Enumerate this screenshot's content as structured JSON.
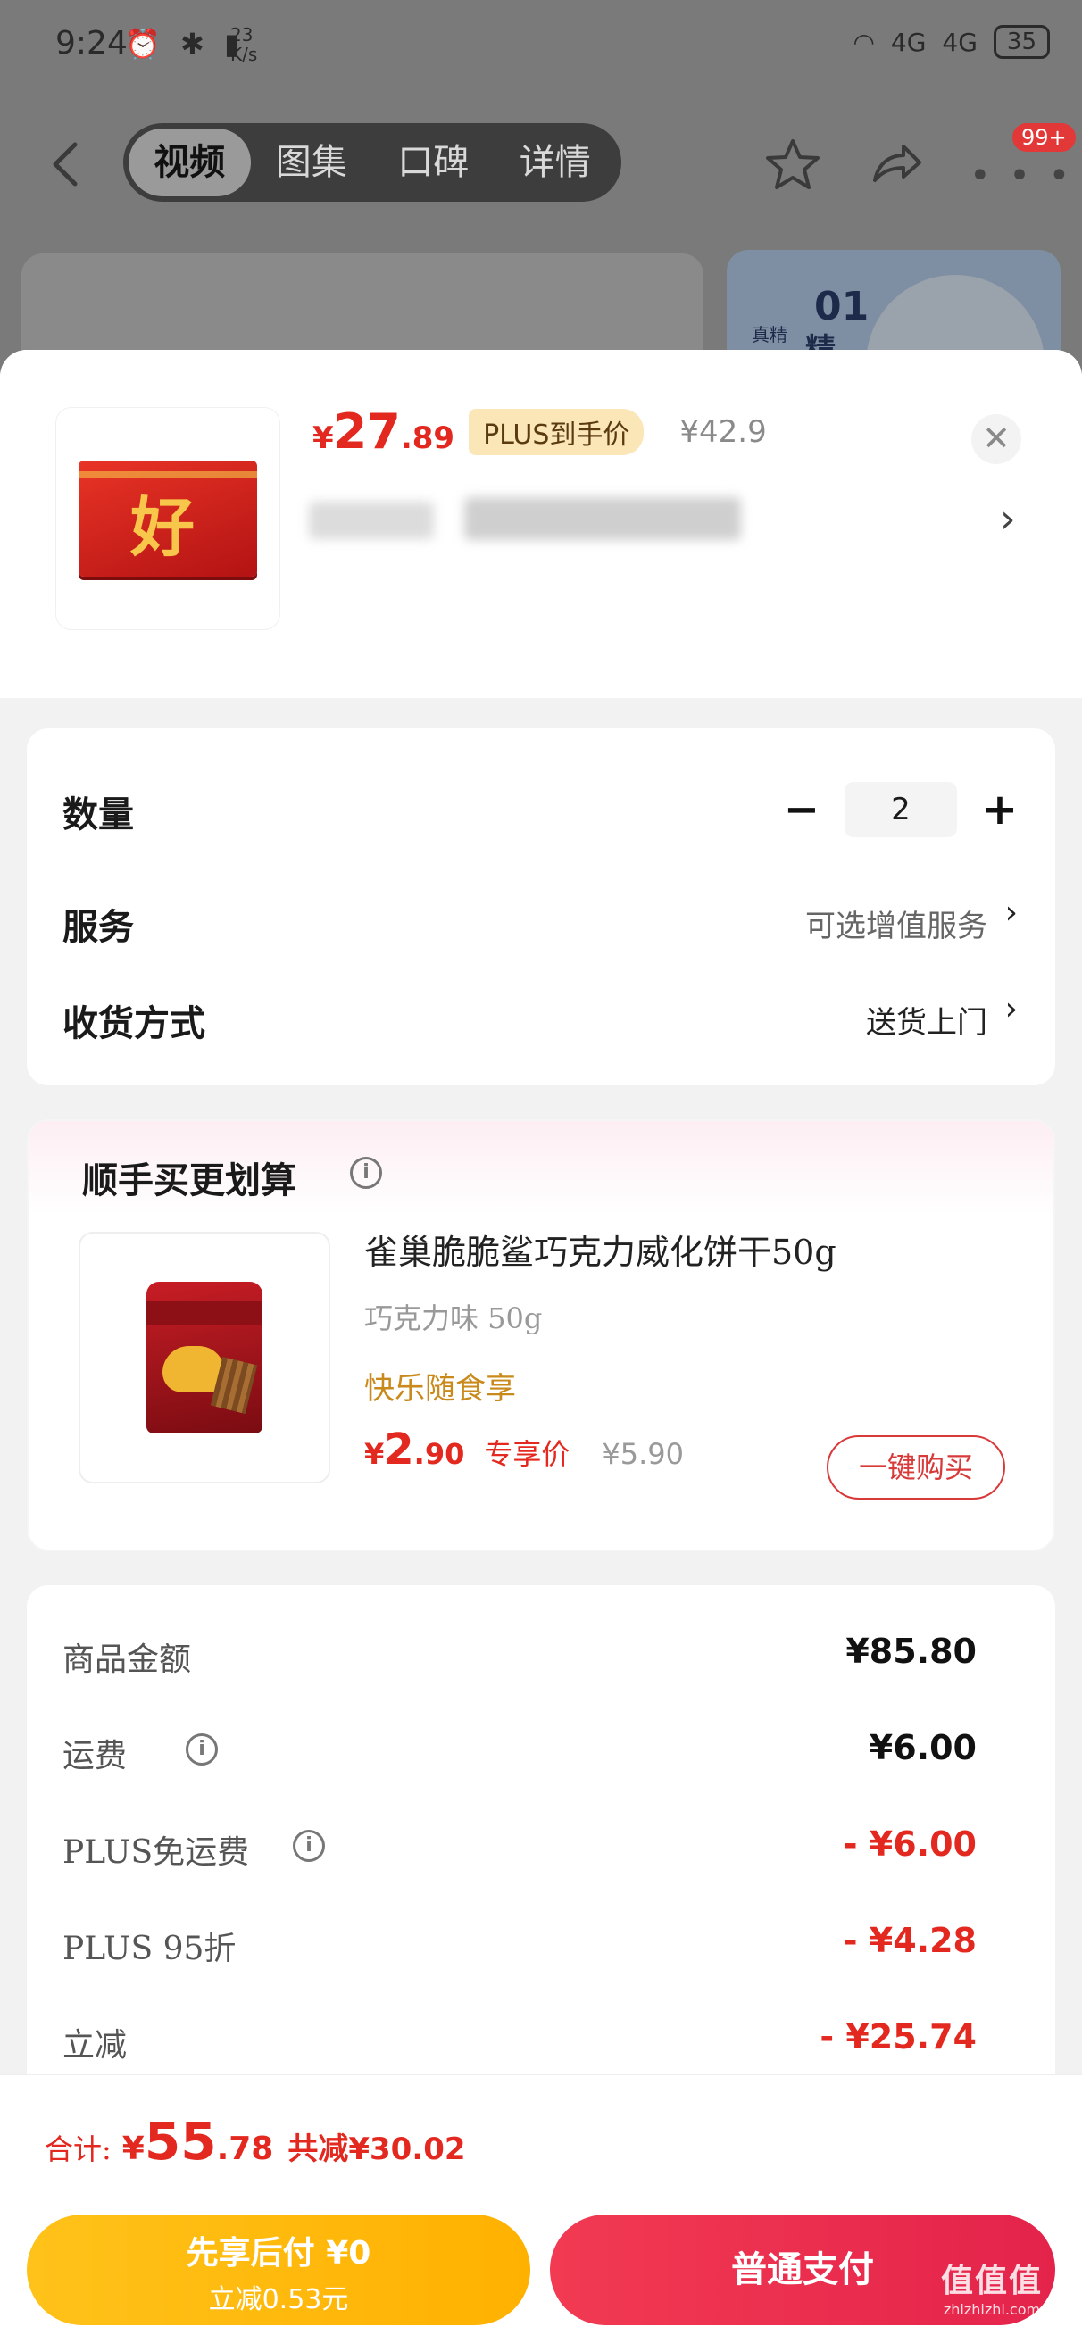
{
  "status_bar": {
    "time": "9:24",
    "speed": "23\nK/s",
    "speed_top": "23",
    "speed_bottom": "K/s",
    "net1": "4G",
    "net2": "4G",
    "battery": "35"
  },
  "top_nav": {
    "tabs": [
      {
        "label": "视频",
        "active": true
      },
      {
        "label": "图集",
        "active": false
      },
      {
        "label": "口碑",
        "active": false
      },
      {
        "label": "详情",
        "active": false
      }
    ],
    "badge": "99+"
  },
  "background_card": {
    "rank_number": "01",
    "rank_label": "精",
    "small_label": "真精"
  },
  "product": {
    "currency": "¥",
    "price_int": "27",
    "price_dec": ".89",
    "plus_tag": "PLUS到手价",
    "original_price": "¥42.9"
  },
  "options": {
    "quantity_label": "数量",
    "quantity_value": "2",
    "minus": "−",
    "plus": "+",
    "service_label": "服务",
    "service_value": "可选增值服务",
    "delivery_label": "收货方式",
    "delivery_value": "送货上门",
    "chevron": "›"
  },
  "addon": {
    "title": "顺手买更划算",
    "name": "雀巢脆脆鲨巧克力威化饼干50g",
    "spec": "巧克力味 50g",
    "slogan": "快乐随食享",
    "currency": "¥",
    "price_int": "2",
    "price_dec": ".90",
    "exclusive_label": "专享价",
    "original_price": "¥5.90",
    "buy_button": "一键购买"
  },
  "summary": {
    "rows": [
      {
        "label": "商品金额",
        "value": "¥85.80",
        "red": false,
        "info": false
      },
      {
        "label": "运费",
        "value": "¥6.00",
        "red": false,
        "info": true
      },
      {
        "label": "PLUS免运费",
        "value": "- ¥6.00",
        "red": true,
        "info": true
      },
      {
        "label": "PLUS 95折",
        "value": "- ¥4.28",
        "red": true,
        "info": false
      },
      {
        "label": "立减",
        "value": "- ¥25.74",
        "red": true,
        "info": false
      }
    ]
  },
  "bottom": {
    "total_label": "合计:",
    "currency": "¥",
    "total_int": "55",
    "total_dec": ".78",
    "saved": "共减¥30.02",
    "later_line1": "先享后付 ¥0",
    "later_line2": "立减0.53元",
    "pay_button": "普通支付"
  },
  "watermark": {
    "line1": "值值值",
    "line2": "zhizhizhi.com"
  },
  "colors": {
    "accent_red": "#e3281f",
    "later_yellow": "#ffb100",
    "pay_red": "#e4234b",
    "plus_tag_bg": "#fbe6b8"
  },
  "icons": [
    "back-arrow-icon",
    "star-icon",
    "share-icon",
    "more-icon",
    "close-icon",
    "chevron-right-icon",
    "info-icon"
  ]
}
